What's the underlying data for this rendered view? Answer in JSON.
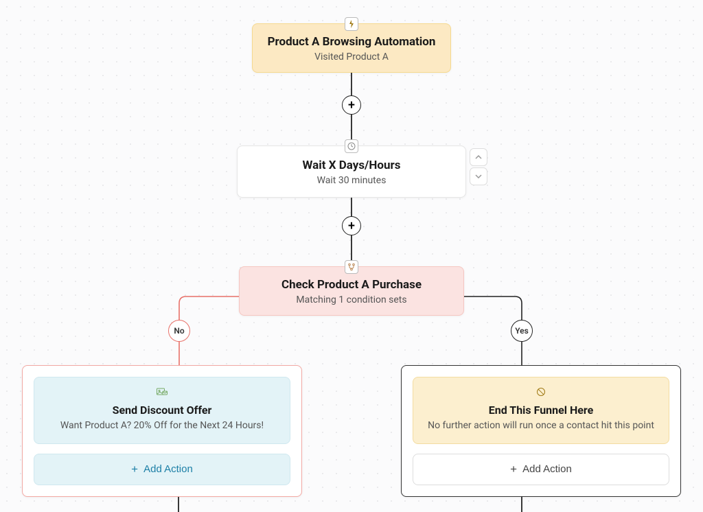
{
  "trigger": {
    "title": "Product A Browsing Automation",
    "subtitle": "Visited Product A",
    "icon": "bolt-icon"
  },
  "wait": {
    "title": "Wait X Days/Hours",
    "subtitle": "Wait 30 minutes",
    "icon": "clock-icon"
  },
  "condition": {
    "title": "Check Product A Purchase",
    "subtitle": "Matching 1 condition sets",
    "icon": "branch-icon"
  },
  "branch": {
    "no_label": "No",
    "yes_label": "Yes"
  },
  "no_path": {
    "card_title": "Send Discount Offer",
    "card_subtitle": "Want Product A? 20% Off for the Next 24 Hours!",
    "card_icon": "mail-image-icon",
    "add_action_label": "Add Action"
  },
  "yes_path": {
    "card_title": "End This Funnel Here",
    "card_subtitle": "No further action will run once a contact hit this point",
    "card_icon": "stop-icon",
    "add_action_label": "Add Action"
  },
  "colors": {
    "yellow": "#fce9c3",
    "pink": "#fbe3e1",
    "red_border": "#f2a8a3"
  }
}
